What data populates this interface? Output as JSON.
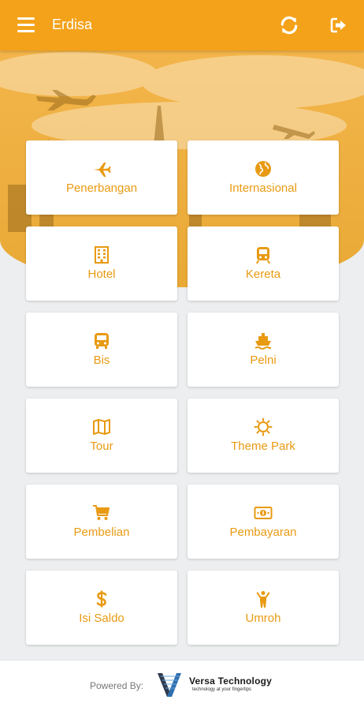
{
  "app": {
    "title": "Erdisa",
    "accent_color": "#f4a21a",
    "icon_color": "#e89a12"
  },
  "toolbar": {
    "menu_icon": "hamburger-menu-icon",
    "refresh_icon": "refresh-icon",
    "logout_icon": "logout-icon"
  },
  "menu": {
    "items": [
      {
        "label": "Penerbangan",
        "icon": "airplane-icon"
      },
      {
        "label": "Internasional",
        "icon": "globe-icon"
      },
      {
        "label": "Hotel",
        "icon": "building-icon"
      },
      {
        "label": "Kereta",
        "icon": "train-icon"
      },
      {
        "label": "Bis",
        "icon": "bus-icon"
      },
      {
        "label": "Pelni",
        "icon": "ship-icon"
      },
      {
        "label": "Tour",
        "icon": "map-icon"
      },
      {
        "label": "Theme Park",
        "icon": "sun-icon"
      },
      {
        "label": "Pembelian",
        "icon": "shopping-cart-icon"
      },
      {
        "label": "Pembayaran",
        "icon": "money-icon"
      },
      {
        "label": "Isi Saldo",
        "icon": "dollar-icon"
      },
      {
        "label": "Umroh",
        "icon": "person-praying-icon"
      }
    ]
  },
  "footer": {
    "powered_by": "Powered By:",
    "company_name": "Versa Technology",
    "tagline": "technology at your fingertips"
  }
}
